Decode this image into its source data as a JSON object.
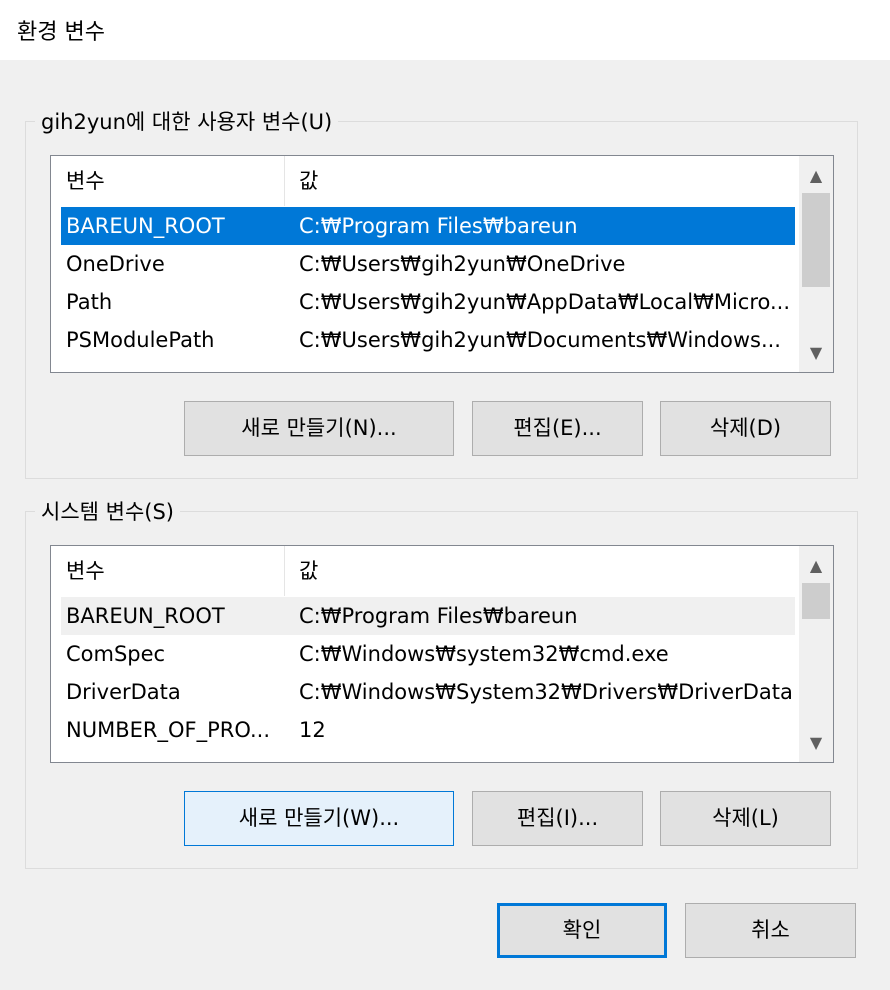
{
  "window": {
    "title": "환경 변수"
  },
  "user_vars": {
    "group_label": "gih2yun에 대한 사용자 변수(U)",
    "columns": [
      "변수",
      "값"
    ],
    "rows": [
      {
        "name": "BAREUN_ROOT",
        "value": "C:₩Program Files₩bareun"
      },
      {
        "name": "OneDrive",
        "value": "C:₩Users₩gih2yun₩OneDrive"
      },
      {
        "name": "Path",
        "value": "C:₩Users₩gih2yun₩AppData₩Local₩Micro..."
      },
      {
        "name": "PSModulePath",
        "value": "C:₩Users₩gih2yun₩Documents₩Windows..."
      }
    ],
    "buttons": {
      "new": "새로 만들기(N)...",
      "edit": "편집(E)...",
      "delete": "삭제(D)"
    }
  },
  "system_vars": {
    "group_label": "시스템 변수(S)",
    "columns": [
      "변수",
      "값"
    ],
    "rows": [
      {
        "name": "BAREUN_ROOT",
        "value": "C:₩Program Files₩bareun"
      },
      {
        "name": "ComSpec",
        "value": "C:₩Windows₩system32₩cmd.exe"
      },
      {
        "name": "DriverData",
        "value": "C:₩Windows₩System32₩Drivers₩DriverData"
      },
      {
        "name": "NUMBER_OF_PRO...",
        "value": "12"
      }
    ],
    "buttons": {
      "new": "새로 만들기(W)...",
      "edit": "편집(I)...",
      "delete": "삭제(L)"
    }
  },
  "footer": {
    "ok": "확인",
    "cancel": "취소"
  },
  "icons": {
    "scroll_up": "▲",
    "scroll_down": "▼"
  }
}
